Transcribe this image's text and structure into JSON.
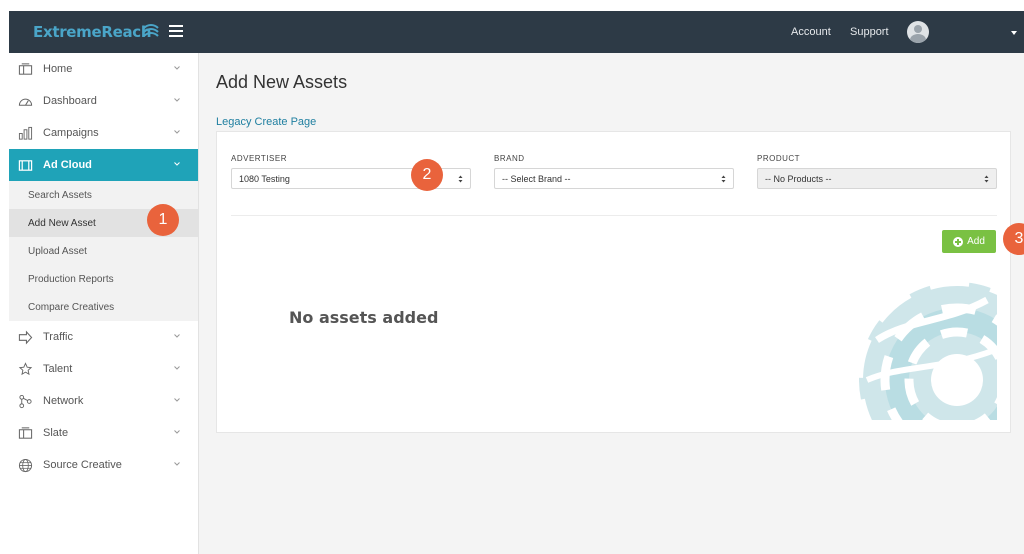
{
  "header": {
    "logo": "ExtremeReach",
    "account_label": "Account",
    "support_label": "Support"
  },
  "sidebar": {
    "items": [
      {
        "label": "Home",
        "icon": "home-icon"
      },
      {
        "label": "Dashboard",
        "icon": "dashboard-icon"
      },
      {
        "label": "Campaigns",
        "icon": "campaigns-icon"
      },
      {
        "label": "Ad Cloud",
        "icon": "ad-cloud-icon"
      },
      {
        "label": "Traffic",
        "icon": "traffic-icon"
      },
      {
        "label": "Talent",
        "icon": "talent-icon"
      },
      {
        "label": "Network",
        "icon": "network-icon"
      },
      {
        "label": "Slate",
        "icon": "slate-icon"
      },
      {
        "label": "Source Creative",
        "icon": "source-creative-icon"
      }
    ],
    "ad_cloud_subitems": [
      "Search Assets",
      "Add New Asset",
      "Upload Asset",
      "Production Reports",
      "Compare Creatives"
    ],
    "active_item": "Ad Cloud",
    "selected_subitem": "Add New Asset"
  },
  "main": {
    "title": "Add New Assets",
    "legacy_link": "Legacy Create Page",
    "advertiser": {
      "label": "ADVERTISER",
      "value": "1080 Testing"
    },
    "brand": {
      "label": "BRAND",
      "value": "-- Select Brand --"
    },
    "product": {
      "label": "PRODUCT",
      "value": "-- No Products --"
    },
    "add_label": "Add",
    "empty_message": "No assets added"
  },
  "markers": [
    "1",
    "2",
    "3"
  ],
  "colors": {
    "topbar": "#2d3a46",
    "brand_teal": "#1fa3b8",
    "add_green": "#7ac143",
    "marker_orange": "#e9633c",
    "link": "#1f7fa0"
  }
}
